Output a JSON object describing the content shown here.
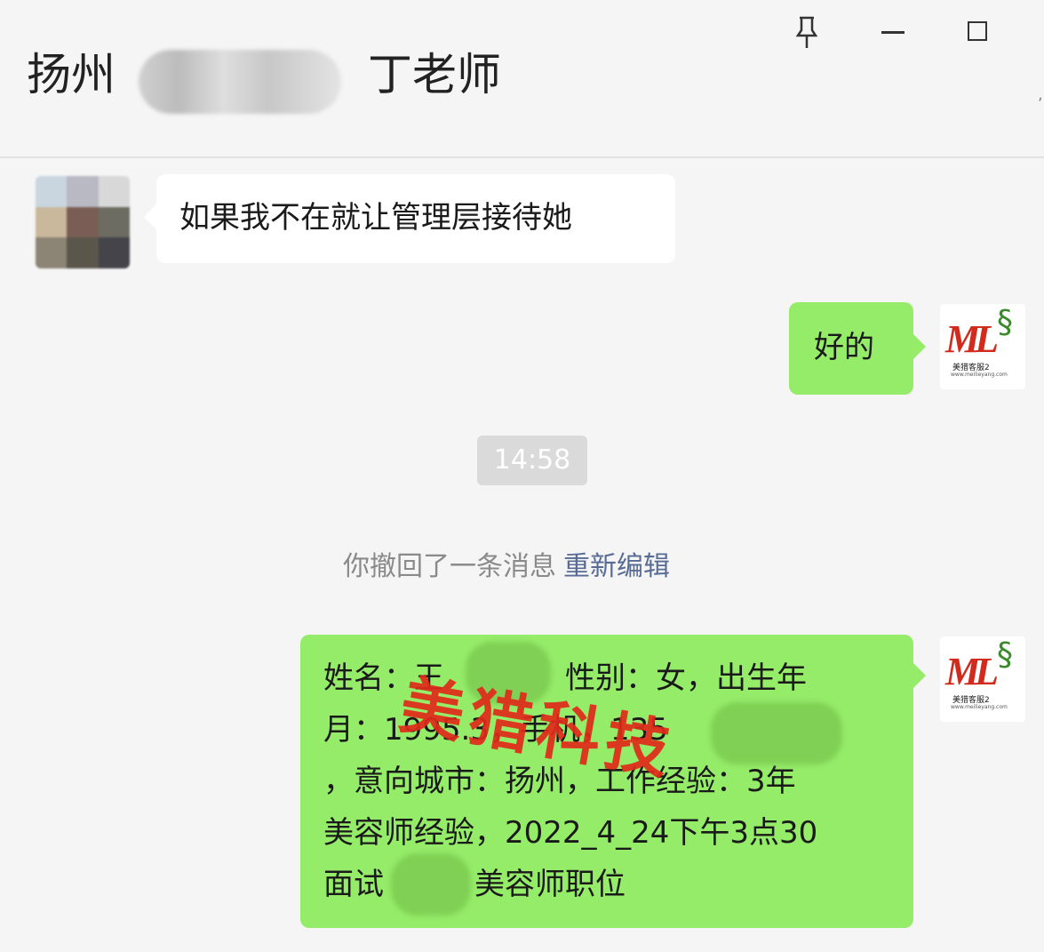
{
  "header": {
    "title_left": "扬州",
    "title_right": "丁老师",
    "pin_icon": "pin-icon",
    "minimize_icon": "minimize-icon",
    "maximize_icon": "maximize-icon"
  },
  "messages": {
    "incoming_1": "如果我不在就让管理层接待她",
    "outgoing_1": "好的",
    "timestamp": "14:58",
    "recall_text": "你撤回了一条消息",
    "recall_link": "重新编辑",
    "outgoing_2_lines": [
      "姓名：王　　　，性别：女，出生年",
      "月：1995.3，手机，135　　　　24",
      "，意向城市：扬州，工作经验：3年",
      "美容师经验，2022_4_24下午3点30",
      "面试　　　美容师职位"
    ]
  },
  "avatar_logo": {
    "mark": "ML",
    "text": "美猎客服2",
    "sub": "www.meilieyang.com"
  },
  "watermark": "美猎科技",
  "colors": {
    "bubble_green": "#95ec69",
    "link_blue": "#576b95",
    "watermark_red": "#e02a1a"
  }
}
